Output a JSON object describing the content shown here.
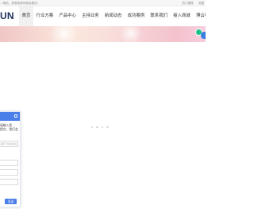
{
  "topbar": {
    "notice": "…网站，您带到我司新品推出！",
    "links": [
      "热门推荐",
      "关键"
    ]
  },
  "header": {
    "logo": "UN",
    "nav": [
      {
        "label": "首页",
        "active": true
      },
      {
        "label": "行业方案",
        "active": false
      },
      {
        "label": "产品中心",
        "active": false
      },
      {
        "label": "主持业务",
        "active": false
      },
      {
        "label": "新闻动态",
        "active": false
      },
      {
        "label": "成功案例",
        "active": false
      },
      {
        "label": "联系我们",
        "active": false
      },
      {
        "label": "接入商城",
        "active": false
      },
      {
        "label": "博云物联平台",
        "active": false
      }
    ]
  },
  "carousel": {
    "dot_count": 4
  },
  "chat": {
    "message": "请输入您\n提交，我们会",
    "placeholder": "请留下您的联系方式",
    "send_label": "发送",
    "accent": "#4a7ee8"
  },
  "colors": {
    "nav_active_bg": "#f1f1f1",
    "logo": "#1c2d5a",
    "float_green": "#19c18a",
    "float_blue": "#3b7fe0"
  }
}
